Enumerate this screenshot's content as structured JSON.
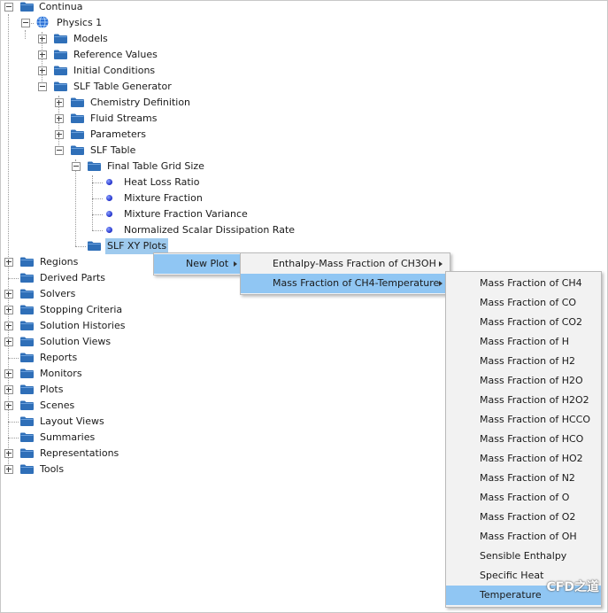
{
  "tree": {
    "continua": "Continua",
    "physics1": "Physics 1",
    "models": "Models",
    "reference_values": "Reference Values",
    "initial_conditions": "Initial Conditions",
    "slf_table_generator": "SLF Table Generator",
    "chemistry_definition": "Chemistry Definition",
    "fluid_streams": "Fluid Streams",
    "parameters": "Parameters",
    "slf_table": "SLF Table",
    "final_table_grid_size": "Final Table Grid Size",
    "heat_loss_ratio": "Heat Loss Ratio",
    "mixture_fraction": "Mixture Fraction",
    "mixture_fraction_variance": "Mixture Fraction Variance",
    "normalized_scalar_dissipation_rate": "Normalized Scalar Dissipation Rate",
    "slf_xy_plots": "SLF XY Plots",
    "regions": "Regions",
    "derived_parts": "Derived Parts",
    "solvers": "Solvers",
    "stopping_criteria": "Stopping Criteria",
    "solution_histories": "Solution Histories",
    "solution_views": "Solution Views",
    "reports": "Reports",
    "monitors": "Monitors",
    "plots": "Plots",
    "scenes": "Scenes",
    "layout_views": "Layout Views",
    "summaries": "Summaries",
    "representations": "Representations",
    "tools": "Tools"
  },
  "menu1": {
    "new_plot": "New Plot"
  },
  "menu2": {
    "enthalpy": "Enthalpy-Mass Fraction of CH3OH",
    "ch4_temp": "Mass Fraction of CH4-Temperature"
  },
  "menu3": {
    "items": [
      "Mass Fraction of CH4",
      "Mass Fraction of CO",
      "Mass Fraction of CO2",
      "Mass Fraction of H",
      "Mass Fraction of H2",
      "Mass Fraction of H2O",
      "Mass Fraction of H2O2",
      "Mass Fraction of HCCO",
      "Mass Fraction of HCO",
      "Mass Fraction of HO2",
      "Mass Fraction of N2",
      "Mass Fraction of O",
      "Mass Fraction of O2",
      "Mass Fraction of OH",
      "Sensible Enthalpy",
      "Specific Heat",
      "Temperature"
    ]
  },
  "watermark": "CFD之道",
  "colors": {
    "folder": "#2f6fb8",
    "selection": "#9ecaee",
    "menu_highlight": "#90c6f3",
    "menu_bg": "#f2f2f2",
    "bullet": "#1f2ec8"
  }
}
